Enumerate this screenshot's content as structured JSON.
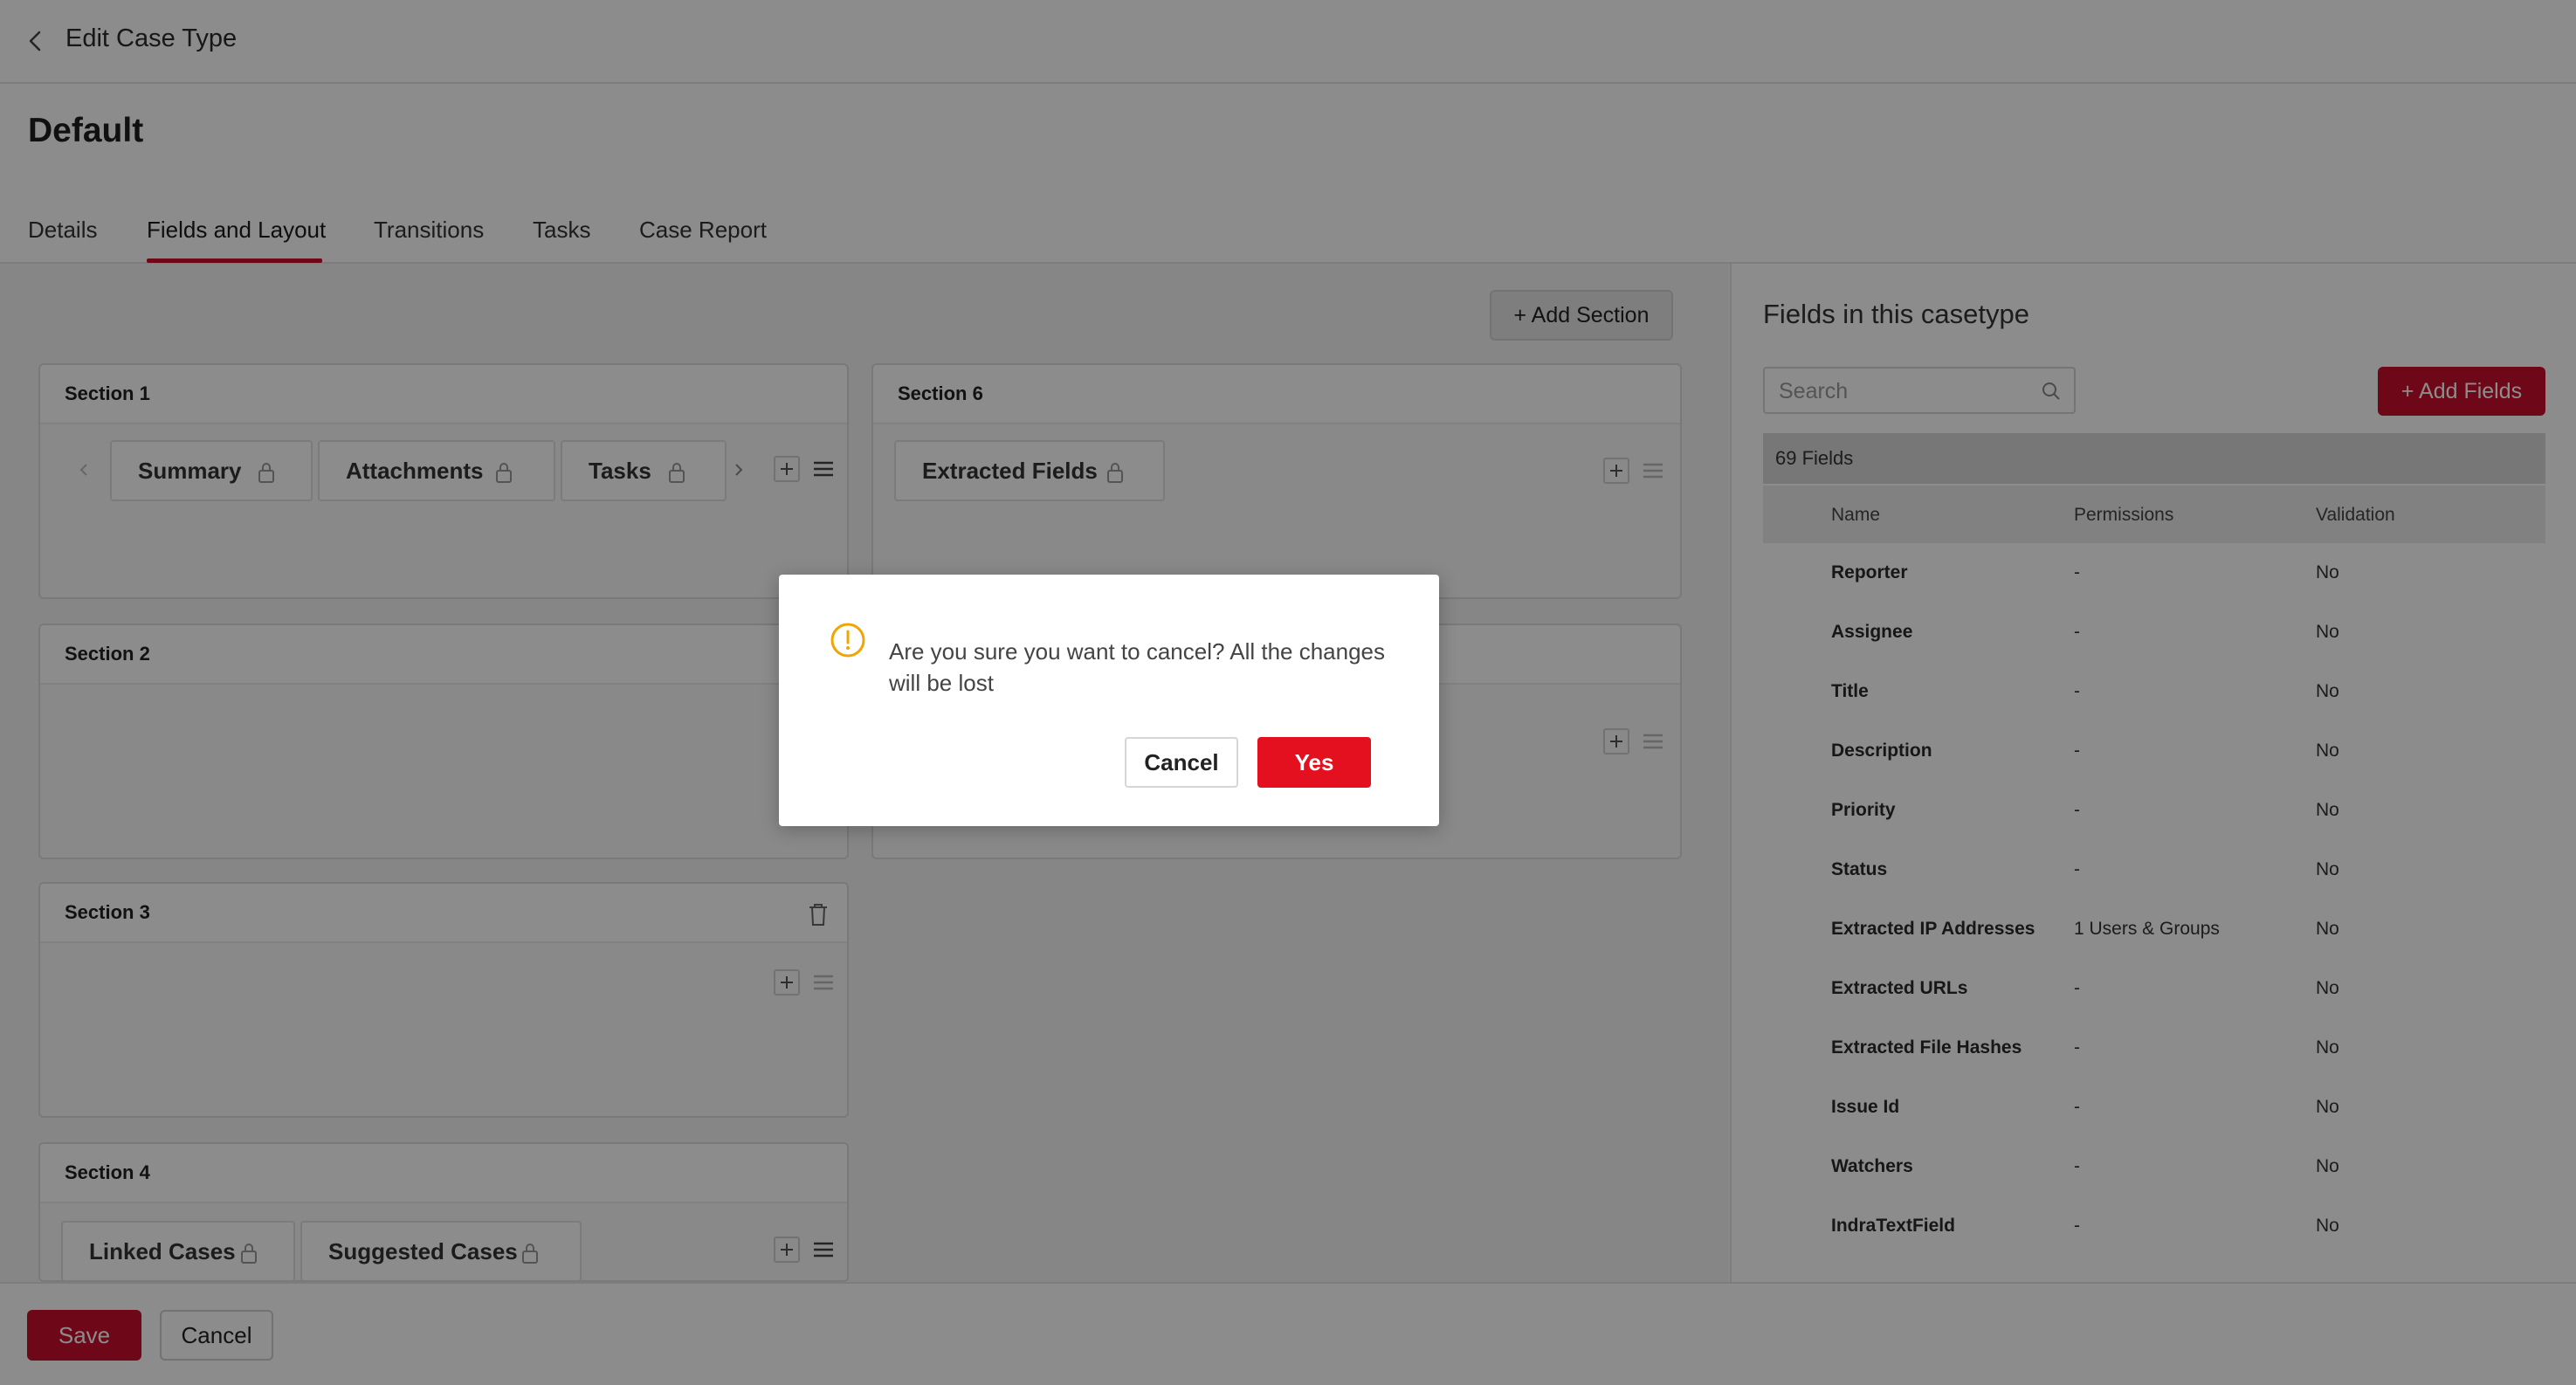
{
  "header": {
    "title": "Edit Case Type"
  },
  "page": {
    "title": "Default"
  },
  "tabs": [
    {
      "label": "Details"
    },
    {
      "label": "Fields and Layout",
      "active": true
    },
    {
      "label": "Transitions"
    },
    {
      "label": "Tasks"
    },
    {
      "label": "Case Report"
    }
  ],
  "layout": {
    "add_section_label": "+ Add Section",
    "sections": [
      {
        "title": "Section 1",
        "fields": [
          "Summary",
          "Attachments",
          "Tasks"
        ]
      },
      {
        "title": "Section 6",
        "fields": [
          "Extracted Fields"
        ]
      },
      {
        "title": "Section 2",
        "fields": []
      },
      {
        "title": "Section 3",
        "fields": []
      },
      {
        "title": "Section 4",
        "fields": [
          "Linked Cases",
          "Suggested Cases"
        ]
      }
    ]
  },
  "fields_panel": {
    "title": "Fields in this casetype",
    "search_placeholder": "Search",
    "add_fields_label": "+ Add Fields",
    "count_label": "69 Fields",
    "columns": [
      "Name",
      "Permissions",
      "Validation"
    ],
    "rows": [
      {
        "name": "Reporter",
        "permissions": "-",
        "validation": "No"
      },
      {
        "name": "Assignee",
        "permissions": "-",
        "validation": "No"
      },
      {
        "name": "Title",
        "permissions": "-",
        "validation": "No"
      },
      {
        "name": "Description",
        "permissions": "-",
        "validation": "No"
      },
      {
        "name": "Priority",
        "permissions": "-",
        "validation": "No"
      },
      {
        "name": "Status",
        "permissions": "-",
        "validation": "No"
      },
      {
        "name": "Extracted IP Addresses",
        "permissions": "1 Users & Groups",
        "validation": "No"
      },
      {
        "name": "Extracted URLs",
        "permissions": "-",
        "validation": "No"
      },
      {
        "name": "Extracted File Hashes",
        "permissions": "-",
        "validation": "No"
      },
      {
        "name": "Issue Id",
        "permissions": "-",
        "validation": "No"
      },
      {
        "name": "Watchers",
        "permissions": "-",
        "validation": "No"
      },
      {
        "name": "IndraTextField",
        "permissions": "-",
        "validation": "No"
      }
    ]
  },
  "footer": {
    "save_label": "Save",
    "cancel_label": "Cancel"
  },
  "dialog": {
    "message": "Are you sure you want to cancel? All the changes will be lost",
    "cancel_label": "Cancel",
    "yes_label": "Yes"
  },
  "colors": {
    "accent": "#c8102e",
    "warning": "#f0a500"
  },
  "icons": [
    "back-icon",
    "lock-icon",
    "plus-icon",
    "menu-icon",
    "chevron-left-icon",
    "chevron-right-icon",
    "trash-icon",
    "search-icon",
    "warning-icon"
  ]
}
